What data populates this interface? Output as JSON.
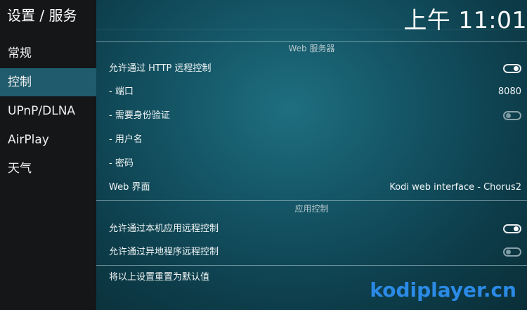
{
  "sidebar": {
    "title": "设置 / 服务",
    "items": [
      {
        "label": "常规"
      },
      {
        "label": "控制"
      },
      {
        "label": "UPnP/DLNA"
      },
      {
        "label": "AirPlay"
      },
      {
        "label": "天气"
      }
    ],
    "active_index": 1
  },
  "header": {
    "clock": "上午 11:01"
  },
  "sections": [
    {
      "title": "Web 服务器",
      "rows": [
        {
          "label": "允许通过 HTTP 远程控制",
          "type": "toggle",
          "state": "on"
        },
        {
          "label": "- 端口",
          "type": "value",
          "value": "8080"
        },
        {
          "label": "- 需要身份验证",
          "type": "toggle",
          "state": "off"
        },
        {
          "label": "- 用户名",
          "type": "value",
          "value": ""
        },
        {
          "label": "- 密码",
          "type": "value",
          "value": ""
        },
        {
          "label": "Web 界面",
          "type": "value",
          "value": "Kodi web interface - Chorus2"
        }
      ]
    },
    {
      "title": "应用控制",
      "rows": [
        {
          "label": "允许通过本机应用远程控制",
          "type": "toggle",
          "state": "on"
        },
        {
          "label": "允许通过异地程序远程控制",
          "type": "toggle",
          "state": "off"
        }
      ]
    },
    {
      "title": "",
      "rows": [
        {
          "label": "将以上设置重置为默认值",
          "type": "action"
        }
      ]
    }
  ],
  "watermark": "kodiplayer.cn",
  "colors": {
    "sidebar_bg": "#141618",
    "active_item": "#1f5b6c",
    "main_bg": "#145566",
    "watermark": "#2b8ae6"
  }
}
